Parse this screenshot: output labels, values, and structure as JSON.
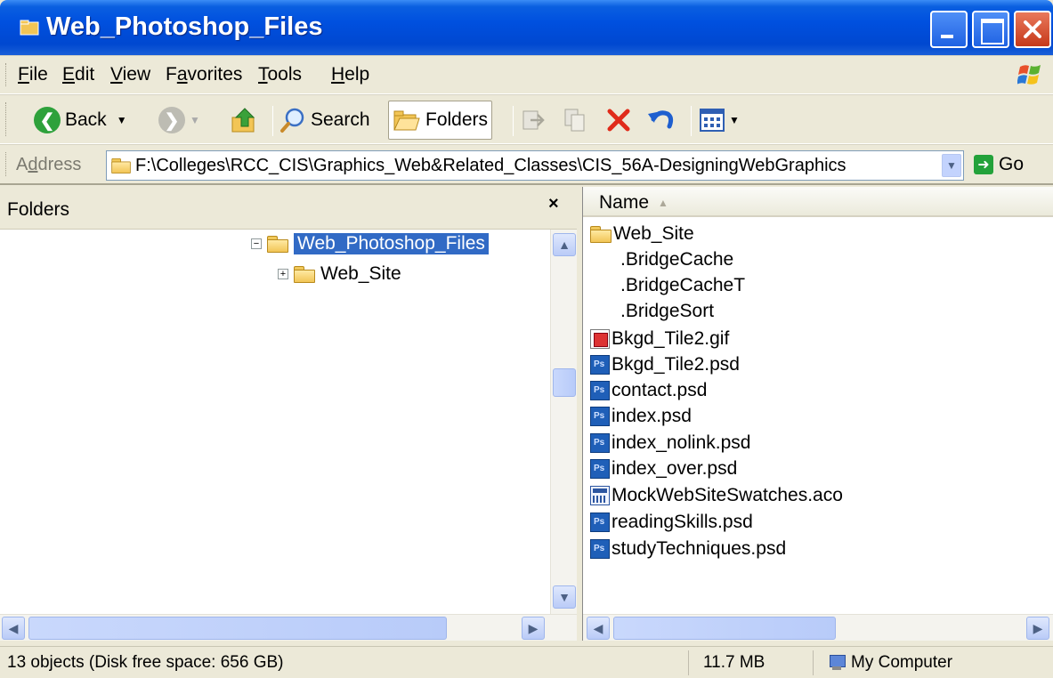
{
  "window": {
    "title": "Web_Photoshop_Files"
  },
  "menubar": {
    "items": [
      {
        "label_u": "F",
        "label_rest": "ile"
      },
      {
        "label_u": "E",
        "label_rest": "dit"
      },
      {
        "label_u": "V",
        "label_rest": "iew"
      },
      {
        "label_pre": "F",
        "label_u": "a",
        "label_rest": "vorites"
      },
      {
        "label_u": "T",
        "label_rest": "ools"
      },
      {
        "label_u": "H",
        "label_rest": "elp"
      }
    ]
  },
  "toolbar": {
    "back_label": "Back",
    "search_label": "Search",
    "folders_label": "Folders",
    "icons": [
      "back-icon",
      "forward-icon",
      "up-folder-icon",
      "search-icon",
      "folders-icon",
      "move-to-icon",
      "copy-to-icon",
      "delete-icon",
      "undo-icon",
      "views-icon"
    ]
  },
  "addressbar": {
    "label_pre": "A",
    "label_u": "d",
    "label_rest": "dress",
    "path": "F:\\Colleges\\RCC_CIS\\Graphics_Web&Related_Classes\\CIS_56A-DesigningWebGraphics",
    "go_label": "Go"
  },
  "folders_pane": {
    "title": "Folders",
    "close_glyph": "×",
    "tree": [
      {
        "label": "Web_Photoshop_Files",
        "expander": "−",
        "selected": true
      },
      {
        "label": "Web_Site",
        "expander": "+",
        "selected": false
      }
    ]
  },
  "files_pane": {
    "column_name": "Name",
    "files": [
      {
        "name": "Web_Site",
        "icon": "folder-icon"
      },
      {
        "name": ".BridgeCache",
        "icon": "blank-file-icon"
      },
      {
        "name": ".BridgeCacheT",
        "icon": "blank-file-icon"
      },
      {
        "name": ".BridgeSort",
        "icon": "blank-file-icon"
      },
      {
        "name": "Bkgd_Tile2.gif",
        "icon": "gif-file-icon"
      },
      {
        "name": "Bkgd_Tile2.psd",
        "icon": "psd-file-icon"
      },
      {
        "name": "contact.psd",
        "icon": "psd-file-icon"
      },
      {
        "name": "index.psd",
        "icon": "psd-file-icon"
      },
      {
        "name": "index_nolink.psd",
        "icon": "psd-file-icon"
      },
      {
        "name": "index_over.psd",
        "icon": "psd-file-icon"
      },
      {
        "name": "MockWebSiteSwatches.aco",
        "icon": "aco-file-icon"
      },
      {
        "name": "readingSkills.psd",
        "icon": "psd-file-icon"
      },
      {
        "name": "studyTechniques.psd",
        "icon": "psd-file-icon"
      }
    ]
  },
  "statusbar": {
    "objects": "13 objects (Disk free space: 656 GB)",
    "size": "11.7 MB",
    "location": "My Computer"
  },
  "colors": {
    "titlebar": "#0050df",
    "selection": "#316ac5",
    "chrome": "#ece9d8"
  }
}
